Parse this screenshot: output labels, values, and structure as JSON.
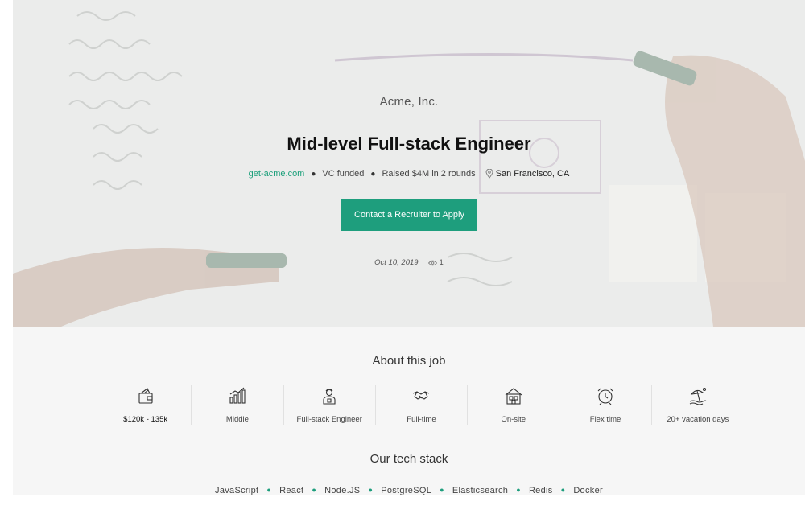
{
  "hero": {
    "company": "Acme, Inc.",
    "title": "Mid-level Full-stack Engineer",
    "website": "get-acme.com",
    "funding": "VC funded",
    "raised": "Raised $4M in 2 rounds",
    "location": "San Francisco, CA",
    "cta_label": "Contact a Recruiter to Apply",
    "date": "Oct 10, 2019",
    "views": "1"
  },
  "about": {
    "title": "About this job",
    "items": [
      {
        "label": "$120k - 135k",
        "icon": "wallet-icon"
      },
      {
        "label": "Middle",
        "icon": "bar-chart-icon"
      },
      {
        "label": "Full-stack Engineer",
        "icon": "engineer-icon"
      },
      {
        "label": "Full-time",
        "icon": "handshake-icon"
      },
      {
        "label": "On-site",
        "icon": "building-icon"
      },
      {
        "label": "Flex time",
        "icon": "alarm-clock-icon"
      },
      {
        "label": "20+ vacation days",
        "icon": "beach-icon"
      }
    ]
  },
  "stack": {
    "title": "Our tech stack",
    "items": [
      "JavaScript",
      "React",
      "Node.JS",
      "PostgreSQL",
      "Elasticsearch",
      "Redis",
      "Docker"
    ]
  },
  "colors": {
    "accent": "#1e9e7d",
    "link": "#1a9f7a"
  }
}
